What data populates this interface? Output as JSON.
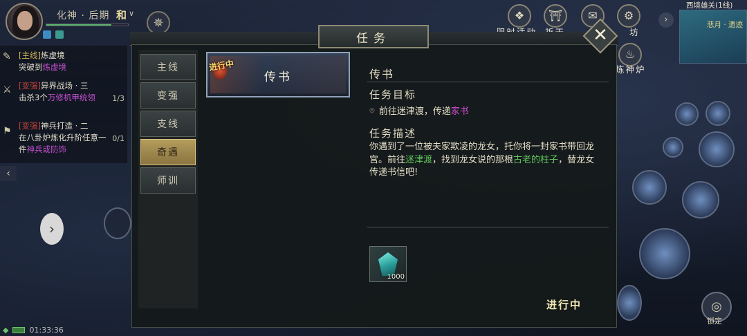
{
  "player": {
    "realm": "化神 · 后期",
    "realm_badge": "和",
    "hp_fraction": 0.8
  },
  "tracker": {
    "items": [
      {
        "tag": "[主线]",
        "title": "炼虚境",
        "line2_prefix": "突破到",
        "line2_highlight": "炼虚境",
        "count": ""
      },
      {
        "tag": "[变强]",
        "title": "异界战场 · 三",
        "line2_prefix": "击杀3个",
        "line2_highlight": "万修机甲统领",
        "count": "1/3"
      },
      {
        "tag": "[变强]",
        "title": "神兵打造 · 二",
        "line2_prefix": "在八卦炉炼化升阶任意一件",
        "line2_highlight": "神兵或防饰",
        "count": "0/1"
      }
    ]
  },
  "status_bar": {
    "time": "01:33:36"
  },
  "top_right": {
    "activities": [
      {
        "label": "限时活动",
        "icon": "event-icon"
      },
      {
        "label": "祈天",
        "icon": "pray-icon"
      },
      {
        "label": "红",
        "icon": "red-envelope-icon"
      },
      {
        "label": "坊",
        "icon": "workshop-icon"
      }
    ],
    "minimap_title": "西境雄关(1线)",
    "minimap_place": "悲月 · 遗迹",
    "furnace_label": "炼神炉"
  },
  "lock_label": "锁定",
  "window": {
    "title": "任务",
    "close_label": "✕",
    "categories": [
      {
        "label": "主线",
        "active": false
      },
      {
        "label": "变强",
        "active": false
      },
      {
        "label": "支线",
        "active": false
      },
      {
        "label": "奇遇",
        "active": true
      },
      {
        "label": "师训",
        "active": false
      }
    ],
    "quest_card": {
      "badge": "进行中",
      "name": "传书"
    },
    "detail": {
      "title": "传书",
      "objective_head": "任务目标",
      "objective_prefix": "前往迷津渡，传递",
      "objective_highlight": "家书",
      "desc_head": "任务描述",
      "desc_part1": "你遇到了一位被夫家欺凌的龙女，托你将一封家书带回龙宫。前往",
      "desc_hl1": "迷津渡",
      "desc_part2": "，找到龙女说的那根",
      "desc_hl2": "古老的柱子",
      "desc_part3": "，替龙女传递书信吧!"
    },
    "reward": {
      "icon": "crystal-icon",
      "qty": "1000"
    },
    "status": "进行中"
  },
  "colors": {
    "highlight_magenta": "#d14ccf",
    "highlight_green": "#5fc75a",
    "active_tab": "#b49c5c",
    "status_gold": "#f2e9b4"
  }
}
